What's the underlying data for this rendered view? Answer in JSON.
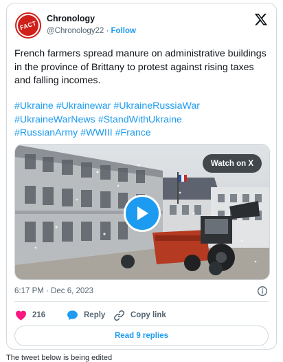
{
  "author": {
    "name": "Chronology",
    "handle": "@Chronology22",
    "separator": "·",
    "follow_label": "Follow",
    "avatar_text": "FACT"
  },
  "tweet": {
    "text": "French farmers spread manure on administrative buildings in the province of Brittany to protest against rising taxes and falling incomes.",
    "hashtags": [
      "#Ukraine",
      "#Ukrainewar",
      "#UkraineRussiaWar",
      "#UkraineWarNews",
      "#StandWithUkraine",
      "#RussianArmy",
      "#WWIII",
      "#France"
    ]
  },
  "media": {
    "watch_label": "Watch on X"
  },
  "timestamp": "6:17 PM · Dec 6, 2023",
  "actions": {
    "like_count": "216",
    "reply_label": "Reply",
    "copy_label": "Copy link"
  },
  "read_replies_label": "Read 9 replies",
  "below_text": "The tweet below is being edited",
  "colors": {
    "accent": "#1d9bf0",
    "like": "#f91880",
    "text": "#0f1419",
    "muted": "#536471",
    "border": "#cfd9de",
    "brand_red": "#d0201a"
  },
  "icons": [
    "fact-stamp-icon",
    "x-logo-icon",
    "play-icon",
    "info-icon",
    "heart-icon",
    "speech-bubble-icon",
    "link-icon"
  ]
}
